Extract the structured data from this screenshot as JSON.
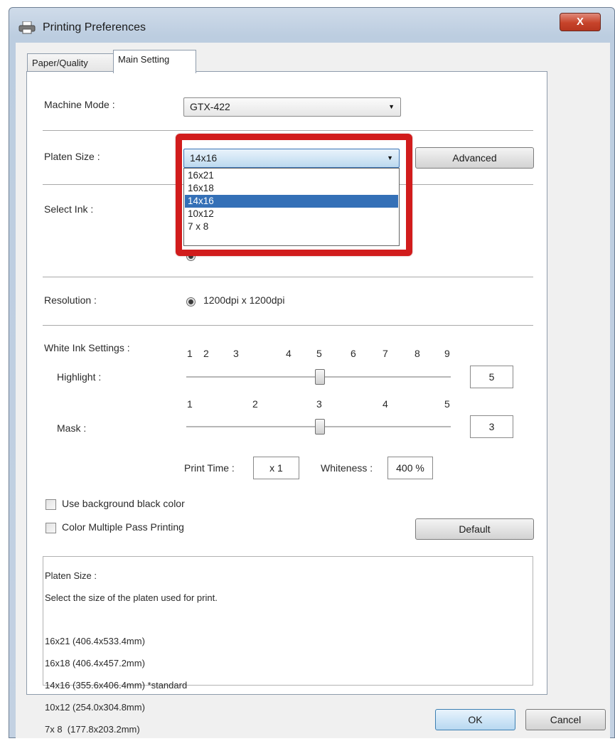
{
  "window": {
    "title": "Printing Preferences",
    "close_label": "X"
  },
  "tabs": [
    {
      "label": "Paper/Quality",
      "active": false
    },
    {
      "label": "Main Setting",
      "active": true
    }
  ],
  "machine_mode": {
    "label": "Machine Mode :",
    "value": "GTX-422"
  },
  "platen_size": {
    "label": "Platen Size :",
    "value": "14x16",
    "advanced_label": "Advanced",
    "options": [
      "16x21",
      "16x18",
      "14x16",
      "10x12",
      "7 x 8"
    ],
    "selected_index": 2
  },
  "select_ink": {
    "label": "Select Ink :"
  },
  "resolution": {
    "label": "Resolution :",
    "value": "1200dpi x 1200dpi"
  },
  "white_ink": {
    "label": "White Ink Settings :",
    "highlight": {
      "label": "Highlight :",
      "ticks": [
        "1",
        "2",
        "3",
        "4",
        "5",
        "6",
        "7",
        "8",
        "9"
      ],
      "value": "5"
    },
    "mask": {
      "label": "Mask :",
      "ticks": [
        "1",
        "2",
        "3",
        "4",
        "5"
      ],
      "value": "3"
    },
    "print_time_label": "Print Time :",
    "print_time_value": "x 1",
    "whiteness_label": "Whiteness :",
    "whiteness_value": "400 %"
  },
  "options": {
    "bg_black_label": "Use background black color",
    "color_multi_pass_label": "Color Multiple Pass Printing",
    "default_label": "Default"
  },
  "description": {
    "title": "Platen Size :",
    "text": "Select the size of the platen used for print.",
    "lines": [
      "16x21 (406.4x533.4mm)",
      "16x18 (406.4x457.2mm)",
      "14x16 (355.6x406.4mm) *standard",
      "10x12 (254.0x304.8mm)",
      "7x 8  (177.8x203.2mm)"
    ]
  },
  "footer": {
    "ok_label": "OK",
    "cancel_label": "Cancel"
  },
  "colors": {
    "highlight_border": "#d11c1c",
    "selection": "#3470b7"
  }
}
